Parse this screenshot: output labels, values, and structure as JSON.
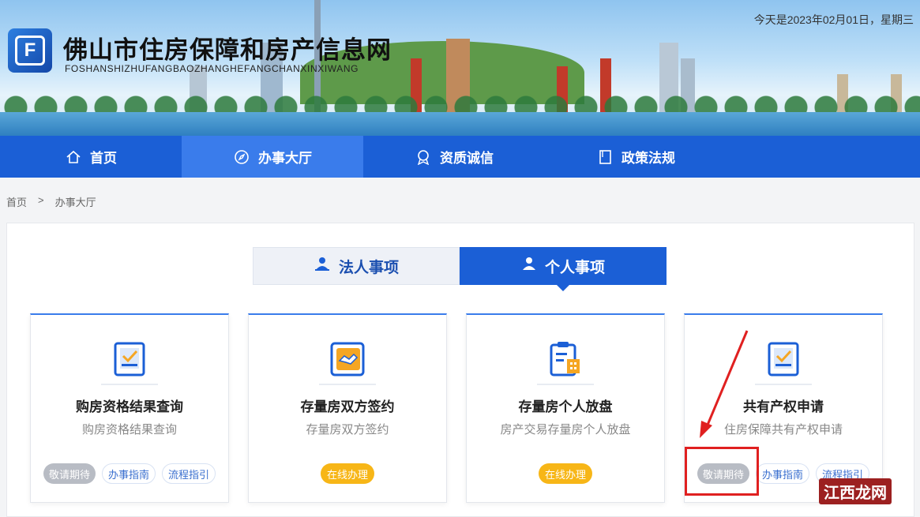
{
  "header": {
    "title": "佛山市住房保障和房产信息网",
    "subtitle": "FOSHANSHIZHUFANGBAOZHANGHEFANGCHANXINXIWANG",
    "date": "今天是2023年02月01日，星期三",
    "logo_letter": "F"
  },
  "nav": {
    "items": [
      {
        "label": "首页",
        "icon": "home-icon"
      },
      {
        "label": "办事大厅",
        "icon": "compass-icon"
      },
      {
        "label": "资质诚信",
        "icon": "badge-icon"
      },
      {
        "label": "政策法规",
        "icon": "document-icon"
      }
    ],
    "active": "办事大厅"
  },
  "breadcrumb": {
    "home": "首页",
    "sep": ">",
    "current": "办事大厅"
  },
  "tabs": [
    {
      "label": "法人事项",
      "icon": "building-user-icon"
    },
    {
      "label": "个人事项",
      "icon": "user-icon"
    }
  ],
  "cards": [
    {
      "title": "购房资格结果查询",
      "desc": "购房资格结果查询",
      "buttons": [
        "敬请期待",
        "办事指南",
        "流程指引"
      ],
      "icon": "checklist-icon"
    },
    {
      "title": "存量房双方签约",
      "desc": "存量房双方签约",
      "buttons": [
        "在线办理"
      ],
      "icon": "handshake-icon"
    },
    {
      "title": "存量房个人放盘",
      "desc": "房产交易存量房个人放盘",
      "buttons": [
        "在线办理"
      ],
      "icon": "clipboard-icon"
    },
    {
      "title": "共有产权申请",
      "desc": "住房保障共有产权申请",
      "buttons": [
        "敬请期待",
        "办事指南",
        "流程指引"
      ],
      "icon": "checklist-icon"
    }
  ],
  "watermark": "江西龙网",
  "colors": {
    "primary": "#1b5fd6",
    "accent": "#f7b617",
    "highlight": "#e02020"
  }
}
